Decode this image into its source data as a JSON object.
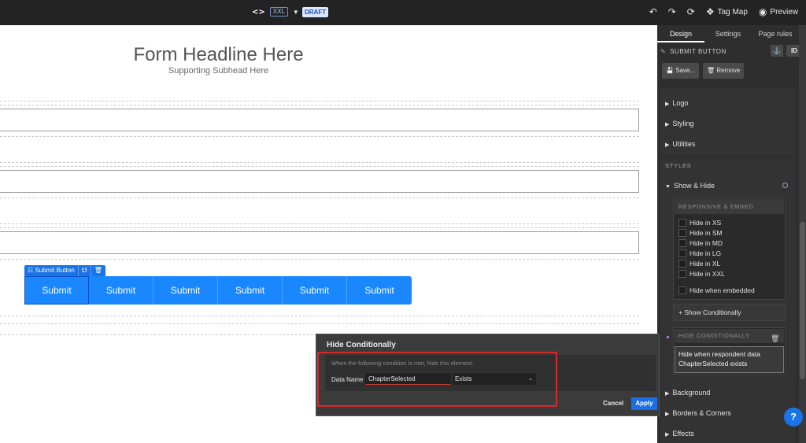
{
  "topbar": {
    "breakpoint": "XXL",
    "status": "DRAFT",
    "tag_map": "Tag Map",
    "preview": "Preview"
  },
  "canvas": {
    "headline": "Form Headline Here",
    "subhead": "Supporting Subhead Here",
    "selected_tag": "Submit Button",
    "buttons": [
      "Submit",
      "Submit",
      "Submit",
      "Submit",
      "Submit",
      "Submit"
    ]
  },
  "modal": {
    "title": "Hide Conditionally",
    "hint": "When the following condition is met, hide this element.",
    "data_name_label": "Data Name",
    "data_name_value": "ChapterSelected",
    "operator": "Exists",
    "cancel": "Cancel",
    "apply": "Apply"
  },
  "panel": {
    "tabs": [
      "Design",
      "Settings",
      "Page rules"
    ],
    "selected": "SUBMIT BUTTON",
    "id_btn": "ID",
    "save": "Save...",
    "remove": "Remove",
    "accordions": [
      "Logo",
      "Styling",
      "Utilities"
    ],
    "styles_label": "STYLES",
    "show_hide": "Show & Hide",
    "responsive_head": "RESPONSIVE & EMBED",
    "checkboxes": [
      "Hide in XS",
      "Hide in SM",
      "Hide in MD",
      "Hide in LG",
      "Hide in XL",
      "Hide in XXL"
    ],
    "hide_embedded": "Hide when embedded",
    "show_conditionally": "+ Show Conditionally",
    "hide_cond_head": "HIDE CONDITIONALLY",
    "hide_cond_text": "Hide when respondent data ChapterSelected exists",
    "bottom_accordions": [
      "Background",
      "Borders & Corners",
      "Effects"
    ]
  },
  "help": "?"
}
